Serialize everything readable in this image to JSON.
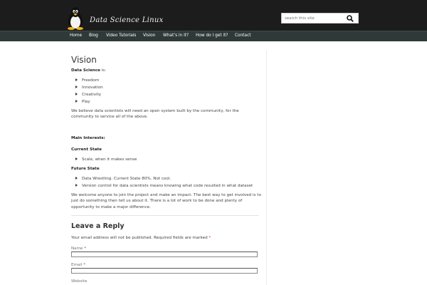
{
  "header": {
    "brand": "Data Science Linux",
    "search": {
      "placeholder": "search this site"
    }
  },
  "nav": {
    "items": [
      "Home",
      "Blog",
      "Video Tutorials",
      "Vision",
      "What’s in it?",
      "How do I get it?",
      "Contact"
    ]
  },
  "page": {
    "title": "Vision",
    "intro_bold": "Data Science",
    "intro_rest": " is:",
    "bullets_1": [
      "Freedom",
      "Innovation",
      "Creativity",
      "Play"
    ],
    "belief": "We believe data scientists will need an open system built by the community, for the community to service all of the above.",
    "main_interests": "Main Interests:",
    "current_state": "Current State",
    "bullets_2": [
      "Scale, when it makes sense"
    ],
    "future_state": "Future State",
    "bullets_3": [
      "Data Wrestling. Current State 80%. Not cool.",
      "Version control for data scientists means knowing what code resulted in what dataset"
    ],
    "welcome": "We welcome anyone to join the project and make an impact.  The best way to get involved is to just do something then tell us about it. There is a lot of work to be done and plenty of opportunity to make a major difference."
  },
  "reply": {
    "title": "Leave a Reply",
    "note": "Your email address will not be published. Required fields are marked",
    "required_mark": "*",
    "name_label": "Name",
    "email_label": "Email",
    "website_label": "Website"
  }
}
